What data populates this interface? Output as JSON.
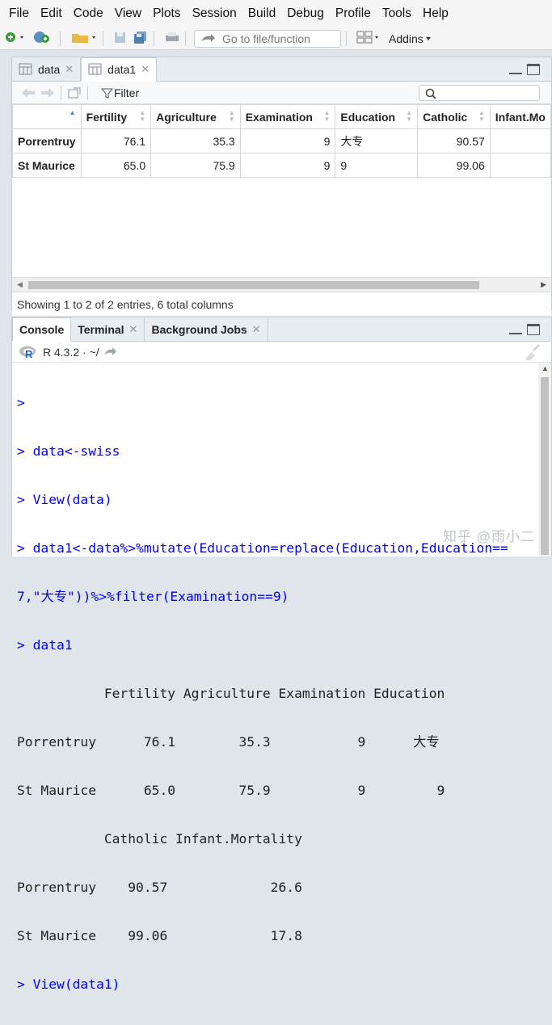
{
  "menu": [
    "File",
    "Edit",
    "Code",
    "View",
    "Plots",
    "Session",
    "Build",
    "Debug",
    "Profile",
    "Tools",
    "Help"
  ],
  "toolbar": {
    "goto_placeholder": "Go to file/function",
    "addins_label": "Addins"
  },
  "viewer": {
    "tabs": [
      {
        "label": "data"
      },
      {
        "label": "data1"
      }
    ],
    "filter_label": "Filter",
    "columns": [
      "",
      "Fertility",
      "Agriculture",
      "Examination",
      "Education",
      "Catholic",
      "Infant.Mo"
    ],
    "rows": [
      {
        "name": "Porrentruy",
        "cells": [
          "76.1",
          "35.3",
          "9",
          "大专",
          "90.57",
          ""
        ]
      },
      {
        "name": "St Maurice",
        "cells": [
          "65.0",
          "75.9",
          "9",
          "9",
          "99.06",
          ""
        ]
      }
    ],
    "status": "Showing 1 to 2 of 2 entries, 6 total columns"
  },
  "console": {
    "tabs": [
      {
        "label": "Console"
      },
      {
        "label": "Terminal"
      },
      {
        "label": "Background Jobs"
      }
    ],
    "r_version": "R 4.3.2 · ~/",
    "lines": [
      {
        "type": "cmd",
        "text": ">"
      },
      {
        "type": "cmd",
        "text": "> data<-swiss"
      },
      {
        "type": "cmd",
        "text": "> View(data)"
      },
      {
        "type": "cmd",
        "text": "> data1<-data%>%mutate(Education=replace(Education,Education=="
      },
      {
        "type": "cmd",
        "text": "7,\"大专\"))%>%filter(Examination==9)"
      },
      {
        "type": "cmd",
        "text": "> data1"
      },
      {
        "type": "out",
        "text": "           Fertility Agriculture Examination Education"
      },
      {
        "type": "out",
        "text": "Porrentruy      76.1        35.3           9      大专"
      },
      {
        "type": "out",
        "text": "St Maurice      65.0        75.9           9         9"
      },
      {
        "type": "out",
        "text": "           Catholic Infant.Mortality"
      },
      {
        "type": "out",
        "text": "Porrentruy    90.57             26.6"
      },
      {
        "type": "out",
        "text": "St Maurice    99.06             17.8"
      },
      {
        "type": "cmd",
        "text": "> View(data1)"
      }
    ]
  },
  "watermark": "知乎 @雨小二"
}
